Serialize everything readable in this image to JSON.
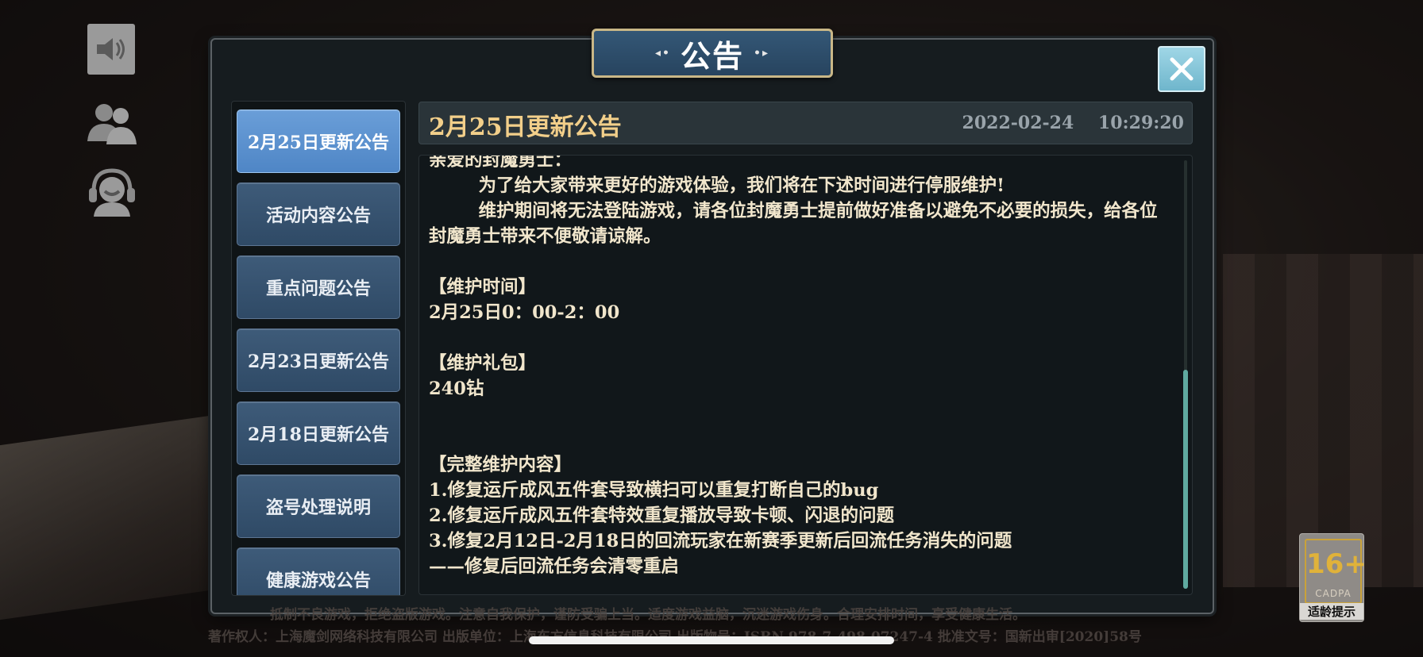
{
  "dialog": {
    "title": "公告",
    "title_ornament": "◂ ▸"
  },
  "tabs": [
    {
      "label": "2月25日更新公告",
      "active": true
    },
    {
      "label": "活动内容公告",
      "active": false
    },
    {
      "label": "重点问题公告",
      "active": false
    },
    {
      "label": "2月23日更新公告",
      "active": false
    },
    {
      "label": "2月18日更新公告",
      "active": false
    },
    {
      "label": "盗号处理说明",
      "active": false
    },
    {
      "label": "健康游戏公告",
      "active": false
    }
  ],
  "announcement": {
    "title": "2月25日更新公告",
    "date": "2022-02-24    10:29:20",
    "lines": [
      "亲爱的封魔勇士：",
      "        为了给大家带来更好的游戏体验，我们将在下述时间进行停服维护!",
      "        维护期间将无法登陆游戏，请各位封魔勇士提前做好准备以避免不必要的损失，给各位封魔勇士带来不便敬请谅解。",
      "",
      "【维护时间】",
      "2月25日0：00-2：00",
      "",
      "【维护礼包】",
      "240钻",
      "",
      "",
      "【完整维护内容】",
      "1.修复运斤成风五件套导致横扫可以重复打断自己的bug",
      "2.修复运斤成风五件套特效重复播放导致卡顿、闪退的问题",
      "3.修复2月12日-2月18日的回流玩家在新赛季更新后回流任务消失的问题",
      "——修复后回流任务会清零重启"
    ]
  },
  "footer": {
    "legal_line1": "抵制不良游戏，拒绝盗版游戏。注意自我保护，谨防受骗上当。适度游戏益脑，沉迷游戏伤身。合理安排时间，享受健康生活。",
    "legal_line2": "著作权人：上海魔剑网络科技有限公司   出版单位：上海东方信息科技有限公司   出版物号：ISBN 978-7-498-07247-4   批准文号：国新出审[2020]58号"
  },
  "age_rating": {
    "age": "16+",
    "org": "CADPA",
    "tip": "适龄提示"
  },
  "icons": {
    "sound": "speaker-icon",
    "friends": "people-icon",
    "support": "customer-service-icon",
    "close": "close-icon"
  },
  "colors": {
    "active_tab": "#5a92cf",
    "tab": "#34506d",
    "title_text": "#f2cf8a",
    "body_text": "#f1e6cc",
    "close_button": "#86c6d9",
    "scroll_thumb": "#5faaa0"
  }
}
